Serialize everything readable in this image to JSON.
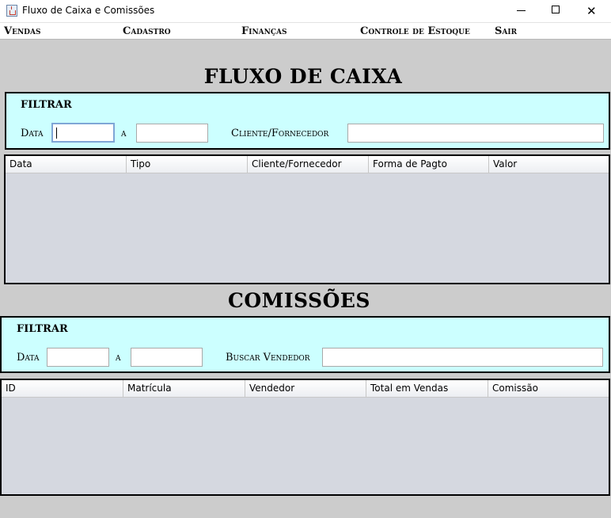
{
  "window": {
    "title": "Fluxo de Caixa e Comissões"
  },
  "menu": {
    "items": [
      {
        "label": "Vendas"
      },
      {
        "label": "Cadastro"
      },
      {
        "label": "Finanças"
      },
      {
        "label": "Controle de Estoque"
      },
      {
        "label": "Sair"
      }
    ]
  },
  "fluxo": {
    "heading": "FLUXO DE CAIXA",
    "filter": {
      "title": "FILTRAR",
      "date_label": "Data",
      "to_label": "a",
      "date_from": "",
      "date_to": "",
      "party_label": "Cliente/Fornecedor",
      "party_value": ""
    },
    "table": {
      "columns": [
        "Data",
        "Tipo",
        "Cliente/Fornecedor",
        "Forma de Pagto",
        "Valor"
      ],
      "rows": []
    }
  },
  "comissoes": {
    "heading": "COMISSÕES",
    "filter": {
      "title": "FILTRAR",
      "date_label": "Data",
      "to_label": "a",
      "date_from": "",
      "date_to": "",
      "seller_label": "Buscar Vendedor",
      "seller_value": ""
    },
    "table": {
      "columns": [
        "ID",
        "Matrícula",
        "Vendedor",
        "Total em Vendas",
        "Comissão"
      ],
      "rows": []
    }
  },
  "icons": {
    "app": "java-cup-icon",
    "minimize": "minimize-icon",
    "maximize": "maximize-icon",
    "close": "close-icon"
  }
}
